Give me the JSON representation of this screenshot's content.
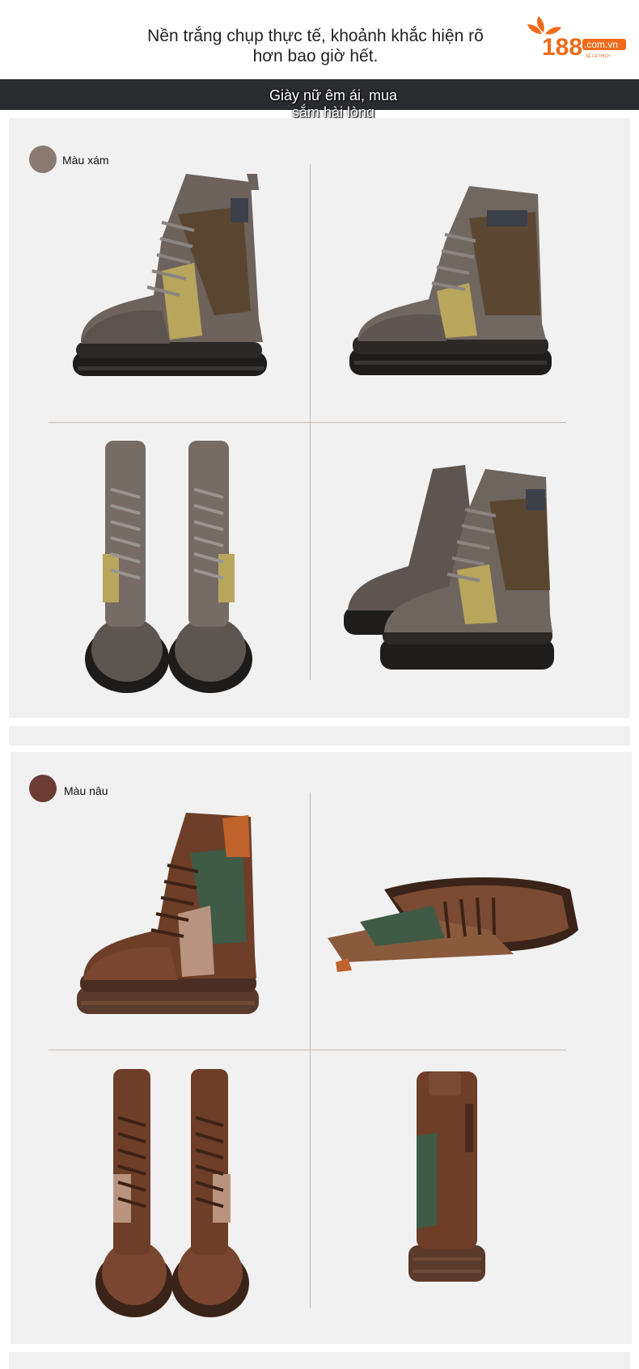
{
  "header": {
    "line1": "Nền trắng chụp thực tế, khoảnh khắc hiện rõ",
    "line2": "hơn bao giờ hết."
  },
  "logo": {
    "number": "188",
    "domain": ".com.vn",
    "tagline": "SẼ LÀ THÍCH"
  },
  "banner": {
    "line1": "Giày nữ êm ái, mua",
    "line2": "sắm hài lòng"
  },
  "sections": [
    {
      "label": "Màu xám",
      "swatch_color": "#8a7a72"
    },
    {
      "label": "Màu nâu",
      "swatch_color": "#6b3b34"
    }
  ],
  "colors": {
    "banner_bg": "#2b2c2f",
    "panel_bg": "#f1f1f1",
    "logo_orange": "#ef6b1a",
    "divider": "#c9b9ae"
  }
}
